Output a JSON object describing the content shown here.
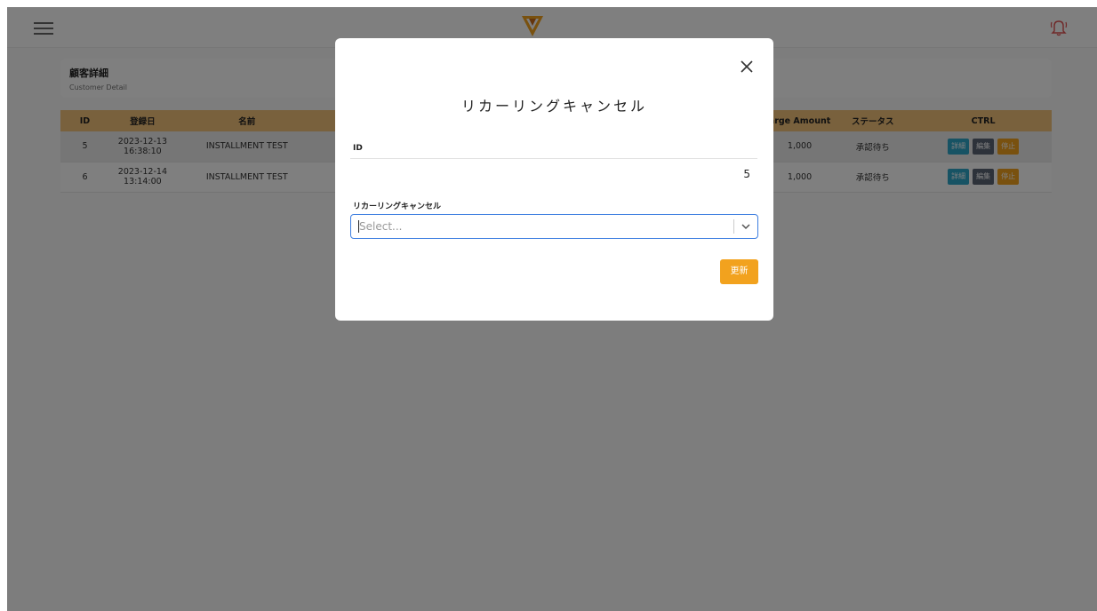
{
  "header": {
    "menu_icon": "hamburger-icon",
    "logo_icon": "brand-logo-v",
    "bell_icon": "bell-icon",
    "accent_color": "#f2a21e",
    "bell_color": "#e05252"
  },
  "page": {
    "title": "顧客詳細",
    "subtitle": "Customer Detail"
  },
  "table": {
    "headers": [
      "ID",
      "登録日",
      "名前",
      "",
      "arge Amount",
      "ステータス",
      "CTRL"
    ],
    "rows": [
      {
        "id": "5",
        "date": "2023-12-13",
        "time": "16:38:10",
        "name": "INSTALLMENT TEST",
        "amount": "1,000",
        "status": "承認待ち"
      },
      {
        "id": "6",
        "date": "2023-12-14",
        "time": "13:14:00",
        "name": "INSTALLMENT TEST",
        "amount": "1,000",
        "status": "承認待ち"
      }
    ],
    "ctrl_buttons": {
      "detail": "詳細",
      "edit": "編集",
      "stop": "停止"
    }
  },
  "modal": {
    "close_icon": "close-icon",
    "title": "リカーリングキャンセル",
    "id_label": "ID",
    "id_value": "5",
    "select_label": "リカーリングキャンセル",
    "select_placeholder": "Select...",
    "select_icon": "chevron-down-icon",
    "update_label": "更新"
  }
}
